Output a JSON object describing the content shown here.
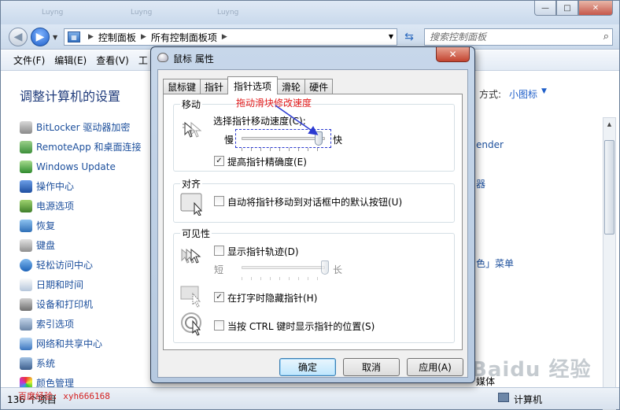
{
  "window": {
    "ghost_tabs": [
      "Luyng",
      "Luyng",
      "Luyng"
    ],
    "buttons": {
      "minimize": "—",
      "maximize": "□",
      "close": "✕"
    }
  },
  "address": {
    "crumbs": [
      "控制面板",
      "所有控制面板项"
    ],
    "search_placeholder": "搜索控制面板"
  },
  "menubar": {
    "items": [
      "文件(F)",
      "编辑(E)",
      "查看(V)",
      "工"
    ]
  },
  "content": {
    "heading": "调整计算机的设置",
    "view_by_label": "方式:",
    "view_by_value": "小图标",
    "items": [
      "BitLocker 驱动器加密",
      "RemoteApp 和桌面连接",
      "Windows Update",
      "操作中心",
      "电源选项",
      "恢复",
      "键盘",
      "轻松访问中心",
      "日期和时间",
      "设备和打印机",
      "索引选项",
      "网络和共享中心",
      "系统",
      "颜色管理"
    ],
    "right_fragments": [
      "ender",
      "器",
      "色」菜单",
      "媒体"
    ]
  },
  "status": {
    "count": "136 个项目",
    "watermark": "百度经验: xyh666168",
    "computer": "计算机",
    "baidu_logo": "Baidu 经验"
  },
  "dialog": {
    "title": "鼠标 属性",
    "close": "✕",
    "tabs": [
      "鼠标键",
      "指针",
      "指针选项",
      "滑轮",
      "硬件"
    ],
    "active_tab": "指针选项",
    "annotation": "拖动滑块修改速度",
    "motion": {
      "title": "移动",
      "speed_label": "选择指针移动速度(C):",
      "slow": "慢",
      "fast": "快",
      "speed_level": 0.92,
      "precision_label": "提高指针精确度(E)",
      "precision_checked": true
    },
    "snap": {
      "title": "对齐",
      "label": "自动将指针移动到对话框中的默认按钮(U)",
      "checked": false
    },
    "visibility": {
      "title": "可见性",
      "trails_label": "显示指针轨迹(D)",
      "trails_checked": false,
      "short": "短",
      "long": "长",
      "trails_level": 1.0,
      "hide_label": "在打字时隐藏指针(H)",
      "hide_checked": true,
      "ctrl_label": "当按 CTRL 键时显示指针的位置(S)",
      "ctrl_checked": false
    },
    "buttons": {
      "ok": "确定",
      "cancel": "取消",
      "apply": "应用(A)"
    }
  }
}
